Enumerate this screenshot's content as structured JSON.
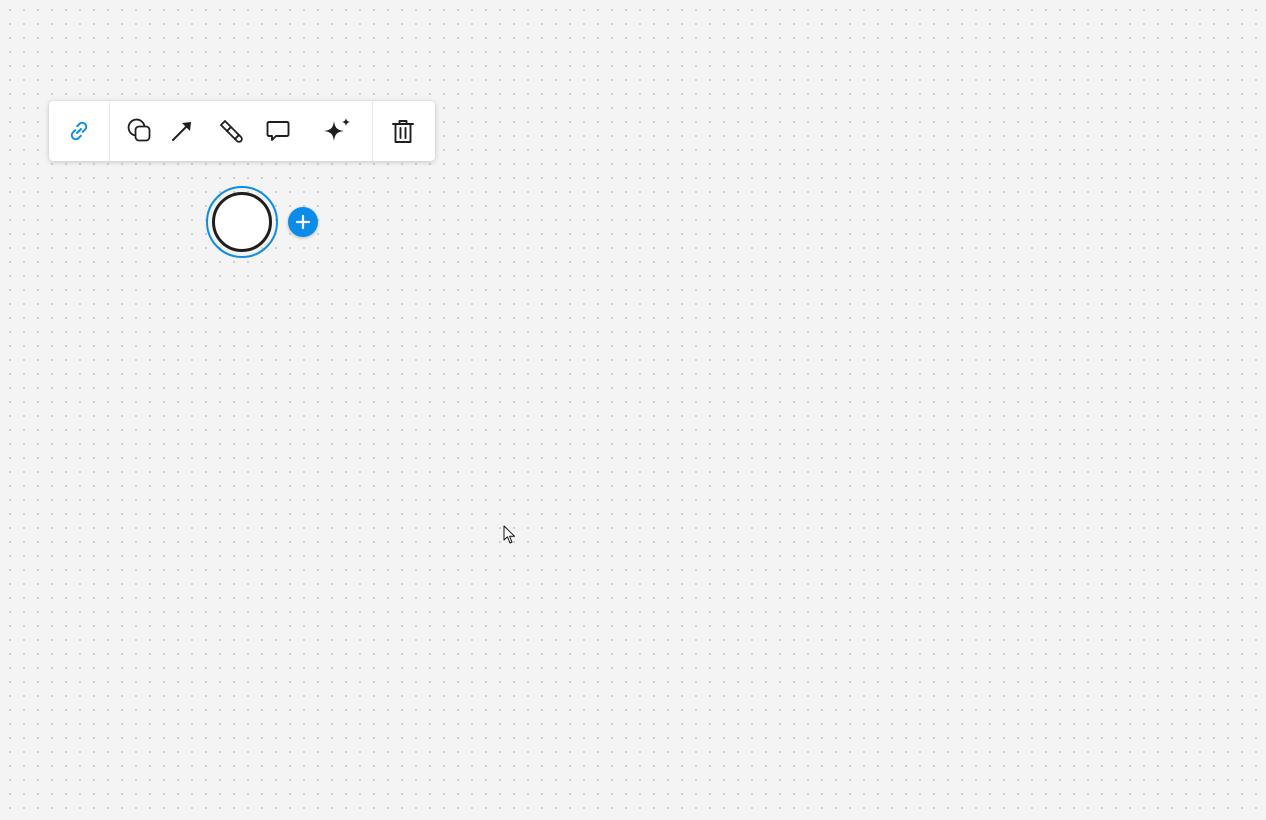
{
  "toolbar": {
    "buttons": [
      {
        "id": "link",
        "icon": "link-icon",
        "active": true
      },
      {
        "id": "shapes",
        "icon": "shapes-icon"
      },
      {
        "id": "arrow",
        "icon": "arrow-icon"
      },
      {
        "id": "style",
        "icon": "paint-brush-icon"
      },
      {
        "id": "comment",
        "icon": "comment-icon"
      },
      {
        "id": "ai",
        "icon": "sparkle-icon"
      },
      {
        "id": "delete",
        "icon": "trash-icon"
      }
    ]
  },
  "colors": {
    "accent": "#0c8ce9",
    "icon": "#1f1f1f",
    "canvas": "#f4f4f4",
    "toolbar_bg": "#ffffff"
  },
  "canvas": {
    "selected_shape": "circle",
    "add_button_icon": "plus-icon"
  }
}
